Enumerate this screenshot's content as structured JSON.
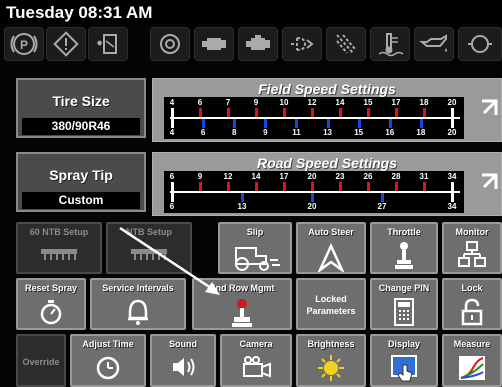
{
  "status": {
    "datetime": "Tuesday 08:31 AM"
  },
  "indicators": [
    {
      "icon": "parking-brake-icon"
    },
    {
      "icon": "warning-icon"
    },
    {
      "icon": "fuel-filter-icon"
    },
    {
      "icon": "brake-icon"
    },
    {
      "icon": "engine-icon"
    },
    {
      "icon": "engine-alt-icon"
    },
    {
      "icon": "glow-plug-icon"
    },
    {
      "icon": "air-filter-icon"
    },
    {
      "icon": "coolant-temp-icon"
    },
    {
      "icon": "oil-pressure-icon"
    },
    {
      "icon": "hydraulic-icon"
    }
  ],
  "tire_size": {
    "title": "Tire Size",
    "value": "380/90R46"
  },
  "spray_tip": {
    "title": "Spray Tip",
    "value": "Custom"
  },
  "field_speed": {
    "title": "Field Speed Settings",
    "top_labels": [
      "4",
      "6",
      "7",
      "9",
      "10",
      "12",
      "14",
      "15",
      "17",
      "18",
      "20"
    ],
    "bottom_labels": [
      "4",
      "6",
      "8",
      "9",
      "11",
      "13",
      "15",
      "16",
      "18",
      "20"
    ]
  },
  "road_speed": {
    "title": "Road Speed Settings",
    "top_labels": [
      "6",
      "9",
      "12",
      "14",
      "17",
      "20",
      "23",
      "26",
      "28",
      "31",
      "34"
    ],
    "bottom_labels": [
      "6",
      "13",
      "20",
      "27",
      "34"
    ]
  },
  "colors": {
    "top_marker": "#e0101e",
    "bottom_marker": "#1a44e8",
    "panel_bg": "#4b4b4b",
    "button_bg": "#6e6e6e"
  },
  "buttons": {
    "ntb60": "60 NTB Setup",
    "ntb": "NTB Setup",
    "slip": "Slip",
    "auto_steer": "Auto Steer",
    "throttle": "Throttle",
    "monitor": "Monitor",
    "reset_spray": "Reset Spray",
    "service_intervals": "Service Intervals",
    "end_row": "End Row Mgmt",
    "locked_params_1": "Locked",
    "locked_params_2": "Parameters",
    "change_pin": "Change PIN",
    "lock": "Lock",
    "override": "Override",
    "adjust_time": "Adjust Time",
    "sound": "Sound",
    "camera": "Camera",
    "brightness": "Brightness",
    "display": "Display",
    "measure": "Measure"
  }
}
